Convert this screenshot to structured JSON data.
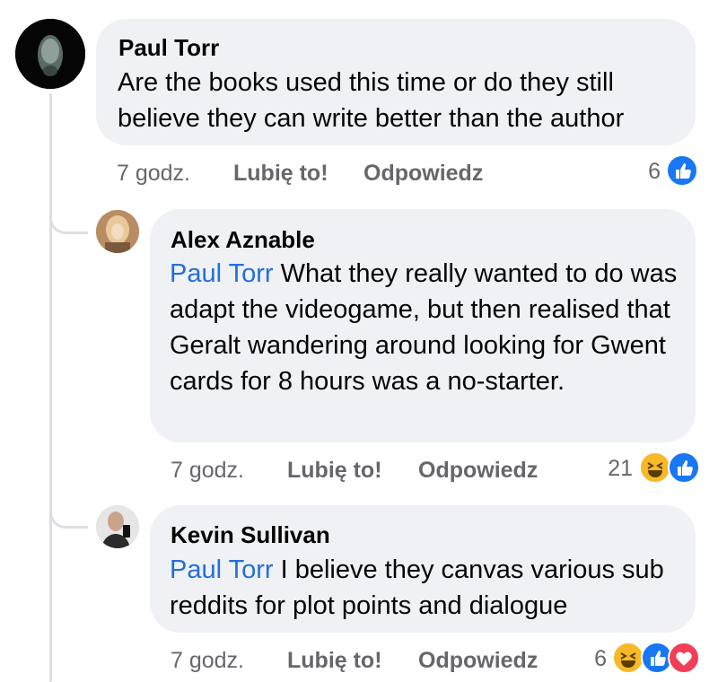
{
  "colors": {
    "accent": "#1877f2",
    "bubble": "#eff1f4",
    "mention": "#216fdb",
    "meta": "#65676b"
  },
  "comments": [
    {
      "author": "Paul Torr",
      "text": "Are the books used this time or do they still believe they can write better than the author",
      "time": "7 godz.",
      "like_label": "Lubię to!",
      "reply_label": "Odpowiedz",
      "reaction_count": "6",
      "reactions": [
        "like-icon"
      ]
    },
    {
      "author": "Alex Aznable",
      "mention": "Paul Torr",
      "text": " What they really wanted to do was adapt the videogame, but then realised that Geralt wandering around looking for Gwent cards for 8 hours was a no-starter.",
      "time": "7 godz.",
      "like_label": "Lubię to!",
      "reply_label": "Odpowiedz",
      "reaction_count": "21",
      "reactions": [
        "haha-icon",
        "like-icon"
      ]
    },
    {
      "author": "Kevin Sullivan",
      "mention": "Paul Torr",
      "text": " I believe they canvas various sub reddits for plot points and dialogue",
      "time": "7 godz.",
      "like_label": "Lubię to!",
      "reply_label": "Odpowiedz",
      "reaction_count": "6",
      "reactions": [
        "haha-icon",
        "like-icon",
        "love-icon"
      ]
    }
  ]
}
